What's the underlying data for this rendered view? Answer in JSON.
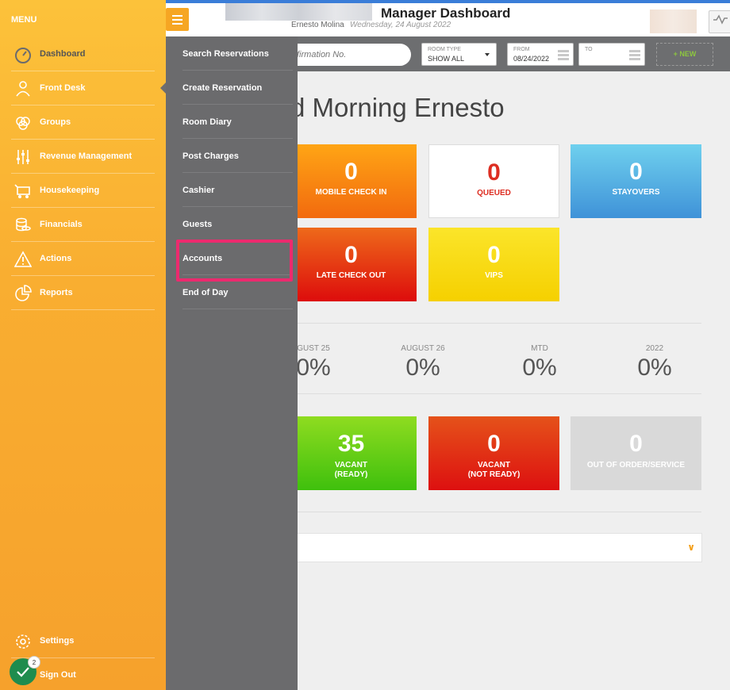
{
  "header": {
    "title": "Manager Dashboard",
    "user_name": "Ernesto Molina",
    "date": "Wednesday, 24 August 2022"
  },
  "filters": {
    "confirmation_placeholder": "firmation No.",
    "room_type": {
      "label": "ROOM TYPE",
      "value": "SHOW ALL"
    },
    "from": {
      "label": "FROM",
      "value": "08/24/2022"
    },
    "to": {
      "label": "TO",
      "value": ""
    },
    "new_label": "+ NEW"
  },
  "greeting": "d Morning Ernesto",
  "tiles": {
    "mobile_check_in": {
      "value": "0",
      "label": "MOBILE CHECK IN"
    },
    "queued": {
      "value": "0",
      "label": "QUEUED"
    },
    "stayovers": {
      "value": "0",
      "label": "STAYOVERS"
    },
    "late_check_out": {
      "value": "0",
      "label": "LATE CHECK OUT"
    },
    "vips": {
      "value": "0",
      "label": "VIPS"
    },
    "vacant_ready": {
      "value": "35",
      "label_line1": "VACANT",
      "label_line2": "(READY)"
    },
    "vacant_not_ready": {
      "value": "0",
      "label_line1": "VACANT",
      "label_line2": "(NOT READY)"
    },
    "out_of_order": {
      "value": "0",
      "label": "OUT OF ORDER/SERVICE"
    }
  },
  "occupancy": [
    {
      "label": "GUST 25",
      "value": "0%"
    },
    {
      "label": "AUGUST 26",
      "value": "0%"
    },
    {
      "label": "MTD",
      "value": "0%"
    },
    {
      "label": "2022",
      "value": "0%"
    }
  ],
  "sidebar": {
    "menu_label": "MENU",
    "items": [
      {
        "label": "Dashboard",
        "icon": "gauge-icon"
      },
      {
        "label": "Front Desk",
        "icon": "bellhop-icon"
      },
      {
        "label": "Groups",
        "icon": "groups-icon"
      },
      {
        "label": "Revenue Management",
        "icon": "sliders-icon"
      },
      {
        "label": "Housekeeping",
        "icon": "cart-icon"
      },
      {
        "label": "Financials",
        "icon": "coins-icon"
      },
      {
        "label": "Actions",
        "icon": "warning-icon"
      },
      {
        "label": "Reports",
        "icon": "pie-chart-icon"
      }
    ],
    "settings": "Settings",
    "sign_out": "Sign Out",
    "badge_count": "2"
  },
  "submenu": {
    "items": [
      "Search Reservations",
      "Create Reservation",
      "Room Diary",
      "Post Charges",
      "Cashier",
      "Guests",
      "Accounts",
      "End of Day"
    ]
  },
  "colors": {
    "sidebar": "#f9ae31",
    "submenu": "#6b6b6d",
    "highlight": "#ec2a6e",
    "badge": "#1e8c4e"
  }
}
